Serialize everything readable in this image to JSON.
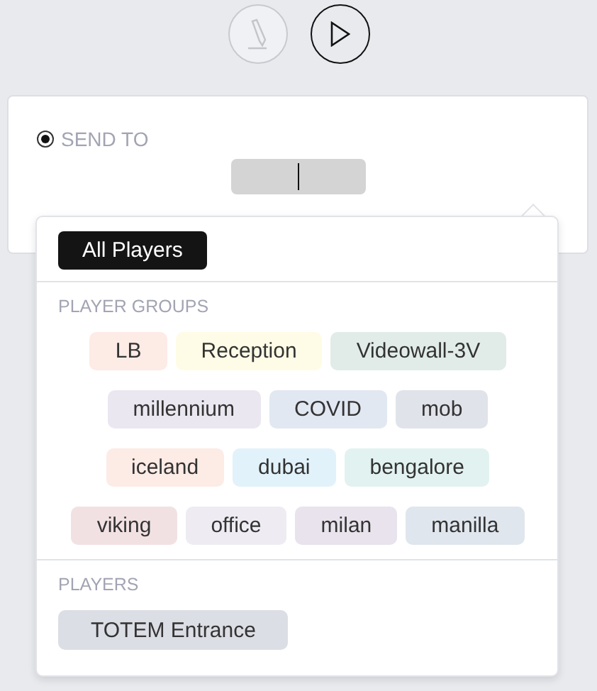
{
  "toolbar": {
    "buttons": [
      {
        "kind": "edit",
        "disabled": true
      },
      {
        "kind": "play",
        "disabled": false
      }
    ]
  },
  "send_to": {
    "label": "SEND TO",
    "selected": true
  },
  "dropdown": {
    "all_button": "All Players",
    "groups_heading": "PLAYER GROUPS",
    "groups": [
      {
        "label": "LB",
        "color": "#fdebe6"
      },
      {
        "label": "Reception",
        "color": "#fefce6"
      },
      {
        "label": "Videowall-3V",
        "color": "#e1ece8"
      },
      {
        "label": "millennium",
        "color": "#ebe7f0"
      },
      {
        "label": "COVID",
        "color": "#e2e8f2"
      },
      {
        "label": "mob",
        "color": "#e0e3ea"
      },
      {
        "label": "iceland",
        "color": "#fdebe6"
      },
      {
        "label": "dubai",
        "color": "#e2f2fa"
      },
      {
        "label": "bengalore",
        "color": "#e2f2f0"
      },
      {
        "label": "viking",
        "color": "#f2e1e3"
      },
      {
        "label": "office",
        "color": "#eeecf2"
      },
      {
        "label": "milan",
        "color": "#e8e3ed"
      },
      {
        "label": "manilla",
        "color": "#e0e6ee"
      }
    ],
    "players_heading": "PLAYERS",
    "players": [
      {
        "label": "TOTEM Entrance"
      }
    ]
  }
}
